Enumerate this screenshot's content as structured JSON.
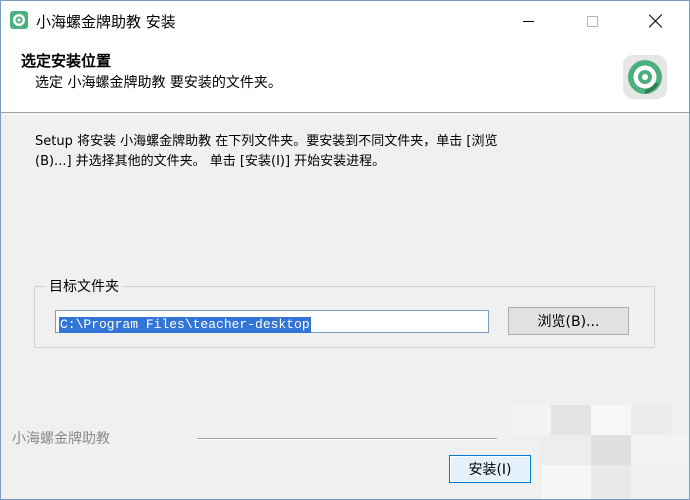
{
  "window": {
    "title": "小海螺金牌助教 安装",
    "controls": [
      "minimize",
      "maximize",
      "close"
    ]
  },
  "header": {
    "title": "选定安装位置",
    "subtitle": "选定 小海螺金牌助教 要安装的文件夹。",
    "icon": "app-logo-icon"
  },
  "description": {
    "line1": "Setup 将安装 小海螺金牌助教 在下列文件夹。要安装到不同文件夹，单击 [浏览",
    "line2": "(B)...] 并选择其他的文件夹。 单击 [安装(I)] 开始安装进程。"
  },
  "destination": {
    "group_label": "目标文件夹",
    "path_value": "C:\\Program Files\\teacher-desktop",
    "browse_label": "浏览(B)..."
  },
  "footer": {
    "brand": "小海螺金牌助教",
    "install_label": "安装(I)"
  },
  "colors": {
    "accent": "#0078d7",
    "selection": "#3375d6",
    "logo_green": "#4caf7d"
  }
}
